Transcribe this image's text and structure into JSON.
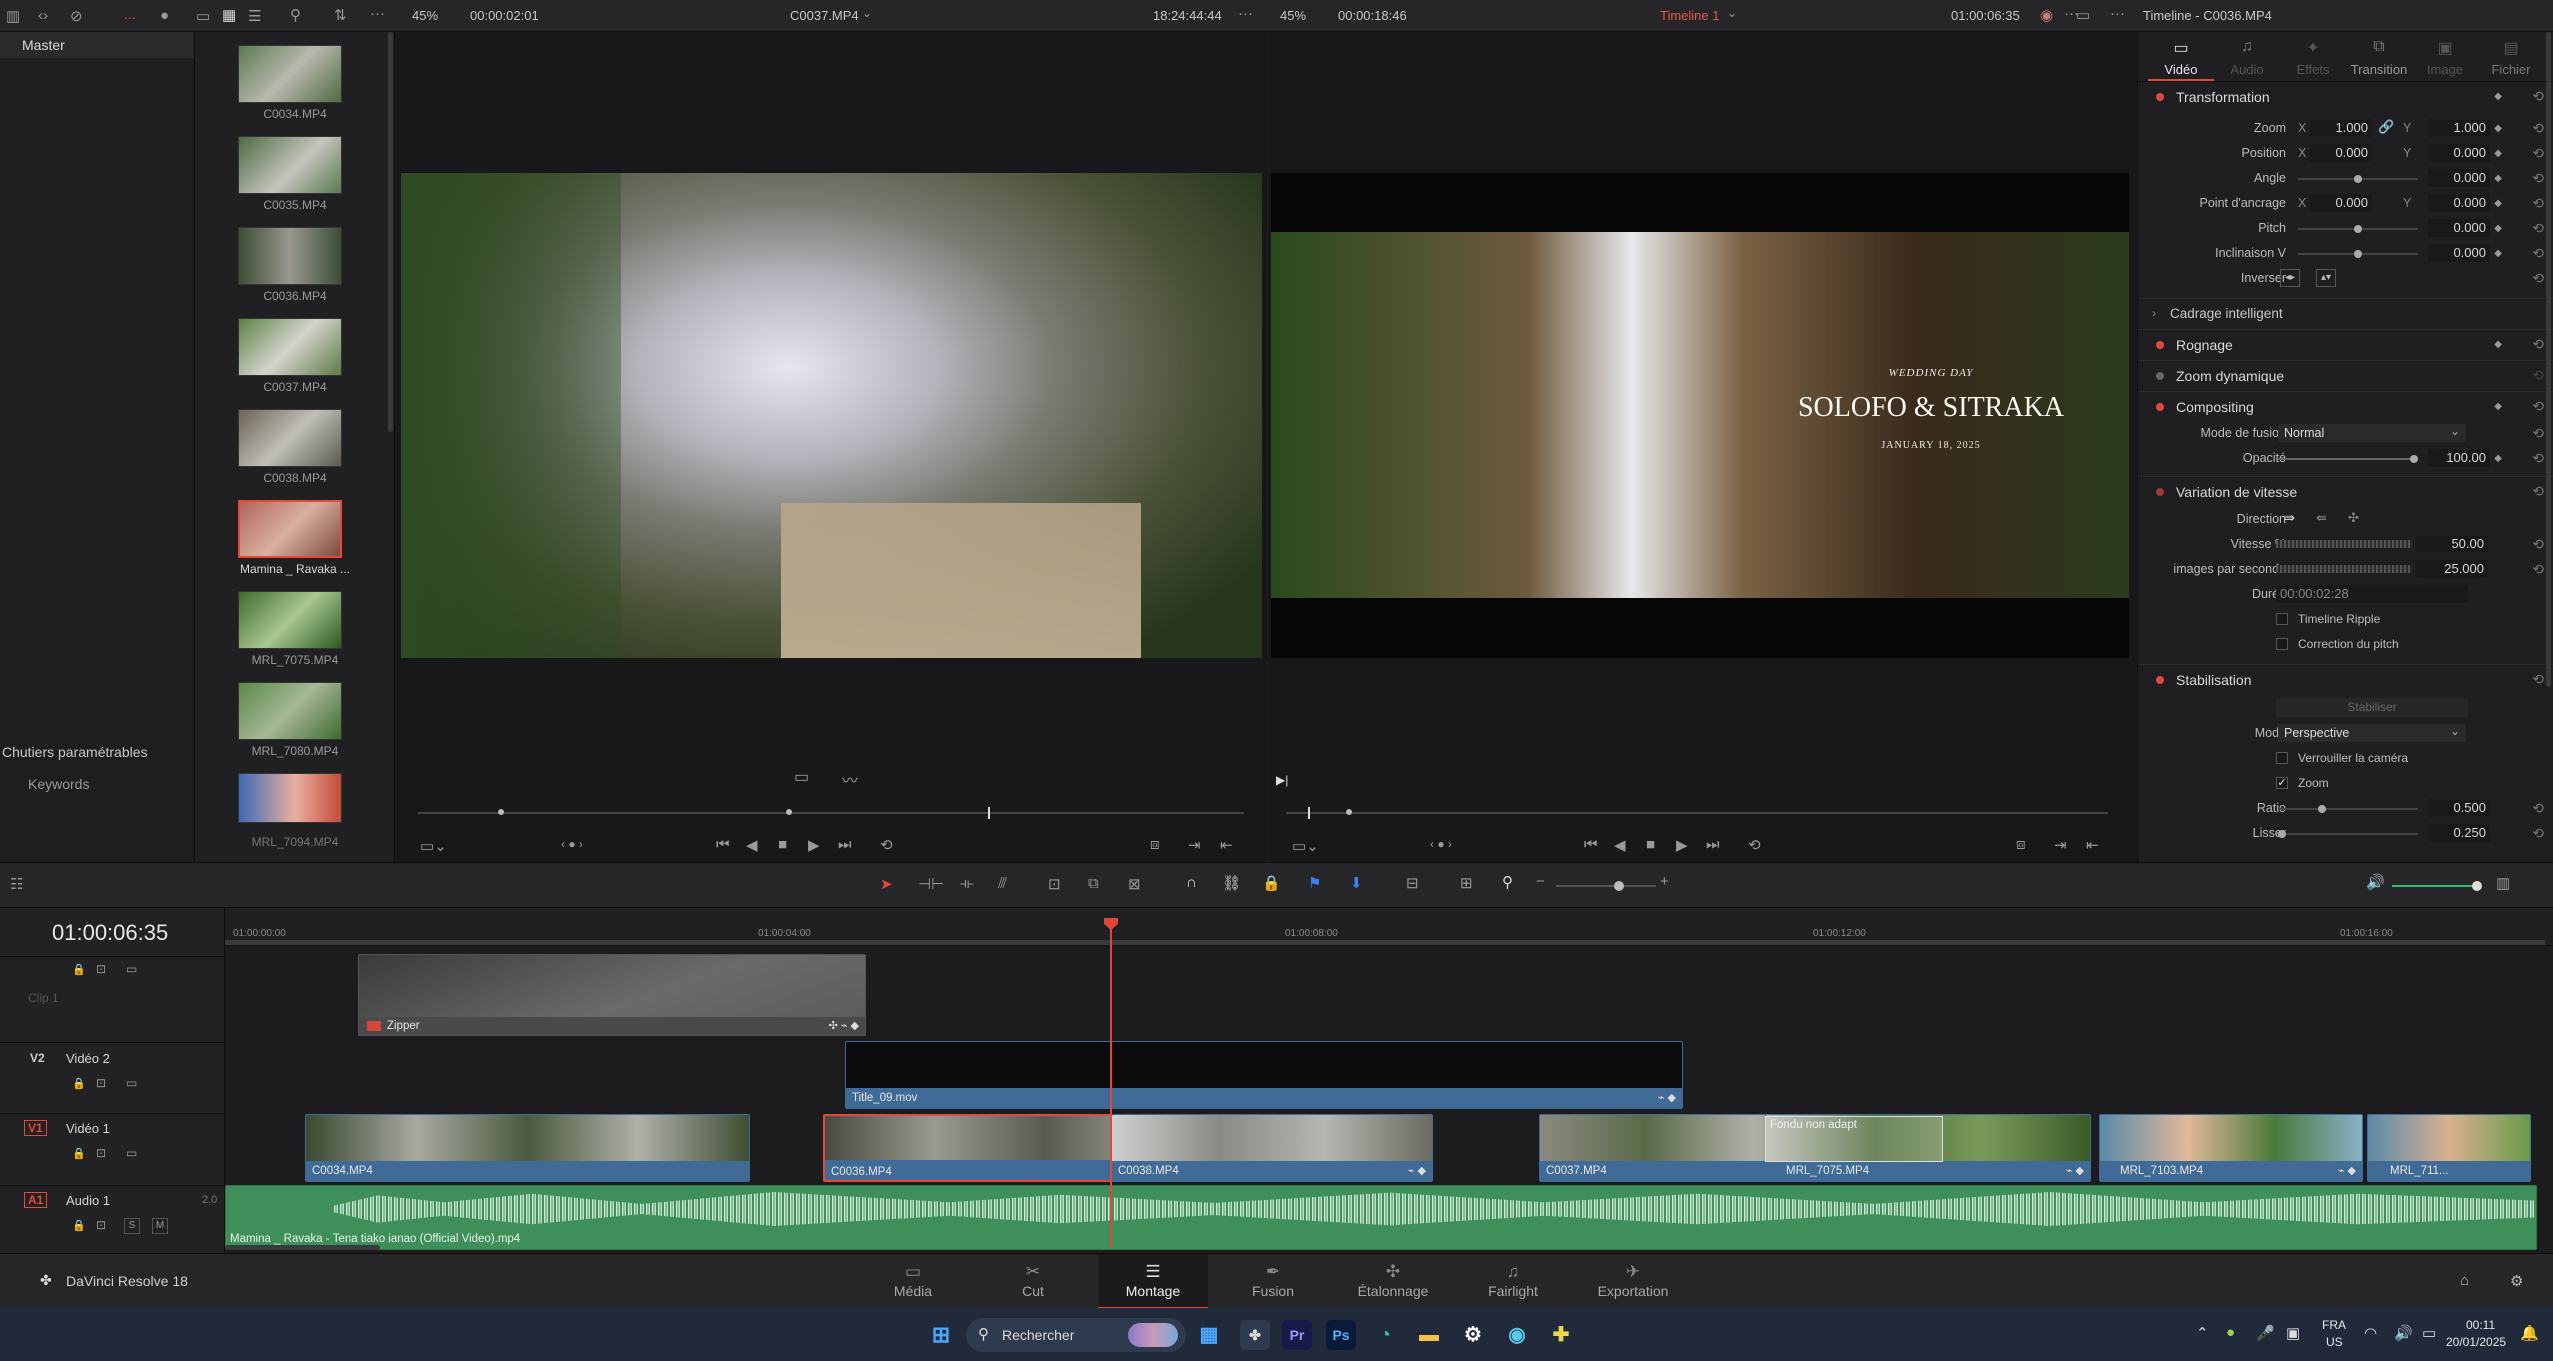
{
  "topbar": {
    "left_zoom": "45%",
    "left_timecode": "00:00:02:01",
    "left_clip": "C0037.MP4",
    "left_tc2": "18:24:44:44",
    "right_zoom": "45%",
    "right_timecode": "00:00:18:46",
    "timeline_name": "Timeline 1",
    "right_tc2": "01:00:06:35",
    "inspector_title": "Timeline - C0036.MP4",
    "more": "..."
  },
  "left_panel": {
    "master": "Master",
    "smart_bins": "Chutiers paramétrables",
    "keywords": "Keywords"
  },
  "media_pool": {
    "clips": [
      {
        "name": "C0034.MP4"
      },
      {
        "name": "C0035.MP4"
      },
      {
        "name": "C0036.MP4"
      },
      {
        "name": "C0037.MP4"
      },
      {
        "name": "C0038.MP4"
      },
      {
        "name": "Mamina _ Ravaka ..."
      },
      {
        "name": "MRL_7075.MP4"
      },
      {
        "name": "MRL_7080.MP4"
      },
      {
        "name": "MRL_7094.MP4"
      }
    ]
  },
  "program_title": {
    "small": "WEDDING DAY",
    "names": "SOLOFO & SITRAKA",
    "date": "JANUARY 18, 2025"
  },
  "inspector": {
    "tabs": [
      "Vidéo",
      "Audio",
      "Effets",
      "Transition",
      "Image",
      "Fichier"
    ],
    "transform": {
      "title": "Transformation",
      "zoom_label": "Zoom",
      "zoom_x": "1.000",
      "zoom_y": "1.000",
      "position_label": "Position",
      "pos_x": "0.000",
      "pos_y": "0.000",
      "angle_label": "Angle",
      "angle": "0.000",
      "anchor_label": "Point d'ancrage",
      "anchor_x": "0.000",
      "anchor_y": "0.000",
      "pitch_label": "Pitch",
      "pitch": "0.000",
      "tilt_label": "Inclinaison V",
      "tilt": "0.000",
      "flip_label": "Inverser",
      "x": "X",
      "y": "Y"
    },
    "smart_reframe": "Cadrage intelligent",
    "crop": "Rognage",
    "dynamic_zoom": "Zoom dynamique",
    "compositing": {
      "title": "Compositing",
      "mode_label": "Mode de fusion",
      "mode": "Normal",
      "opacity_label": "Opacité",
      "opacity": "100.00"
    },
    "speed": {
      "title": "Variation de vitesse",
      "direction_label": "Direction",
      "speed_label": "Vitesse %",
      "speed": "50.00",
      "fps_label": "images par seconde",
      "fps": "25.000",
      "duration_label": "Durée",
      "duration": "00:00:02:28",
      "ripple": "Timeline Ripple",
      "pitch_corr": "Correction du pitch"
    },
    "stabilization": {
      "title": "Stabilisation",
      "button": "Stabiliser",
      "mode_label": "Mode",
      "mode": "Perspective",
      "lock_cam": "Verrouiller la caméra",
      "zoom": "Zoom",
      "ratio_label": "Ratio",
      "ratio": "0.500",
      "smooth_label": "Lisser",
      "smooth": "0.250"
    }
  },
  "timeline": {
    "timecode": "01:00:06:35",
    "ruler": [
      "01:00:00:00",
      "01:00:04:00",
      "01:00:08:00",
      "01:00:12:00",
      "01:00:16:00"
    ],
    "tracks": {
      "clip1": "Clip 1",
      "v2_tag": "V2",
      "v2_name": "Vidéo 2",
      "v1_tag": "V1",
      "v1_name": "Vidéo 1",
      "a1_tag": "A1",
      "a1_name": "Audio 1",
      "a1_ch": "2.0",
      "s": "S",
      "m": "M"
    },
    "clips": {
      "zipper": "Zipper",
      "title": "Title_09.mov",
      "v1": [
        "C0034.MP4",
        "C0036.MP4",
        "C0038.MP4",
        "C0037.MP4",
        "MRL_7075.MP4",
        "MRL_7103.MP4",
        "MRL_711..."
      ],
      "transition": "Fondu non adapt",
      "audio": "Mamina _ Ravaka - Tena tiako ianao (Official Video).mp4"
    }
  },
  "bottom_nav": {
    "brand": "DaVinci Resolve 18",
    "pages": [
      "Média",
      "Cut",
      "Montage",
      "Fusion",
      "Étalonnage",
      "Fairlight",
      "Exportation"
    ],
    "active": "Montage"
  },
  "taskbar": {
    "search": "Rechercher",
    "lang1": "FRA",
    "lang2": "US",
    "time": "00:11",
    "date": "20/01/2025",
    "pr": "Pr",
    "ps": "Ps"
  },
  "colors": {
    "accent_red": "#e34a3c",
    "video_clip": "#3f6b96",
    "audio_clip": "#3f8f5b",
    "playhead": "#e2453b"
  },
  "chart_data": null
}
